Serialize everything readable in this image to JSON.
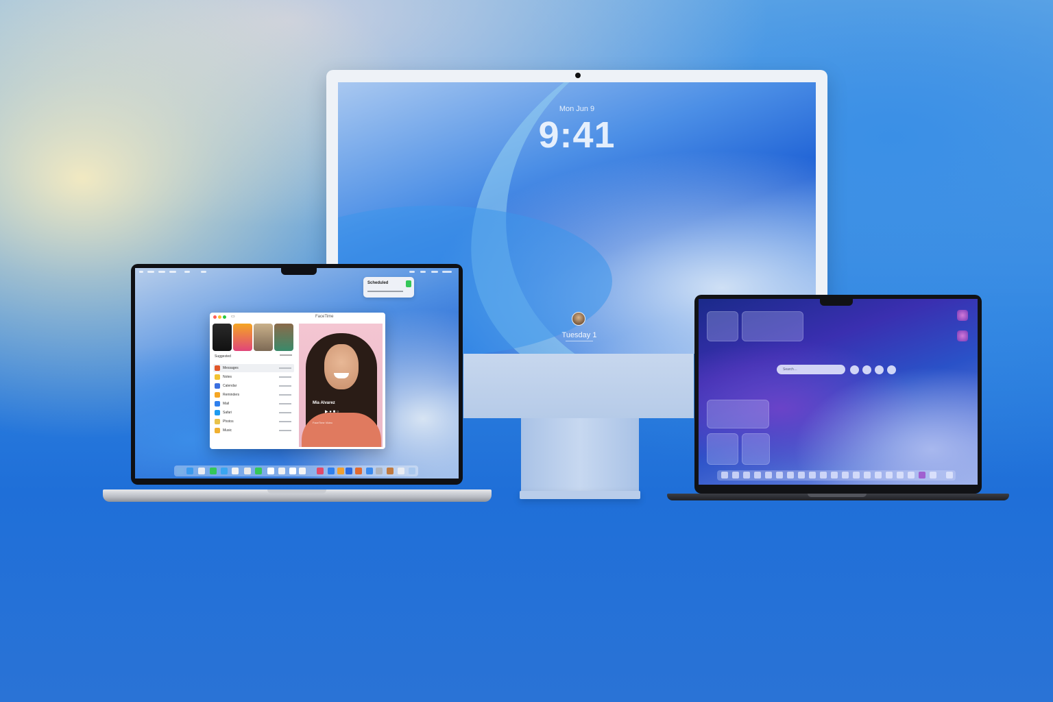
{
  "imac": {
    "lock_date": "Mon Jun 9",
    "lock_time": "9:41",
    "user_name": "Tuesday 1"
  },
  "macbook_pro": {
    "notification": {
      "title": "Scheduled"
    },
    "facetime": {
      "title": "FaceTime",
      "video_icon": "video-icon",
      "section_label": "Suggested",
      "rows": [
        {
          "label": "Messages",
          "color": "#e0572a"
        },
        {
          "label": "Notes",
          "color": "#f2c230"
        },
        {
          "label": "Calendar",
          "color": "#3a6fe0"
        },
        {
          "label": "Reminders",
          "color": "#f5a623"
        },
        {
          "label": "Mail",
          "color": "#2f80ed"
        },
        {
          "label": "Safari",
          "color": "#1e9bf0"
        },
        {
          "label": "Photos",
          "color": "#e8c24a"
        },
        {
          "label": "Music",
          "color": "#f0b030"
        }
      ],
      "caption": "Mia Alvarez",
      "subcaption": "FaceTime Video",
      "controls": "▶ ● ■ ○"
    }
  },
  "macbook_air": {
    "search_placeholder": "Search…"
  },
  "colors": {
    "accent_blue": "#1f6fd8",
    "facetime_green": "#34c759"
  }
}
